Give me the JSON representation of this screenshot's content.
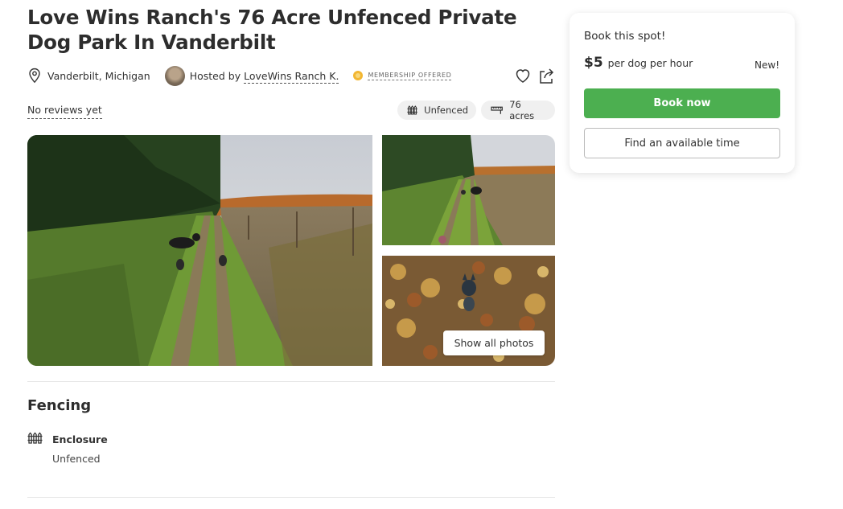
{
  "listing": {
    "title": "Love Wins Ranch's 76 Acre Unfenced Private Dog Park In Vanderbilt",
    "location": "Vanderbilt, Michigan",
    "hosted_by_prefix": "Hosted by",
    "host_name": "LoveWins Ranch K.",
    "membership_badge": "MEMBERSHIP OFFERED",
    "reviews": "No reviews yet",
    "chips": [
      {
        "icon": "fence-icon",
        "label": "Unfenced"
      },
      {
        "icon": "ruler-icon",
        "label": "76 acres"
      }
    ],
    "show_all_photos": "Show all photos"
  },
  "fencing": {
    "heading": "Fencing",
    "items": [
      {
        "icon": "fence-icon",
        "label": "Enclosure",
        "value": "Unfenced"
      }
    ]
  },
  "booking": {
    "title": "Book this spot!",
    "price": "$5",
    "price_unit": "per dog per hour",
    "new_tag": "New!",
    "book_now": "Book now",
    "find_time": "Find an available time"
  },
  "colors": {
    "accent": "#4caf50",
    "badge": "#f2b632"
  }
}
